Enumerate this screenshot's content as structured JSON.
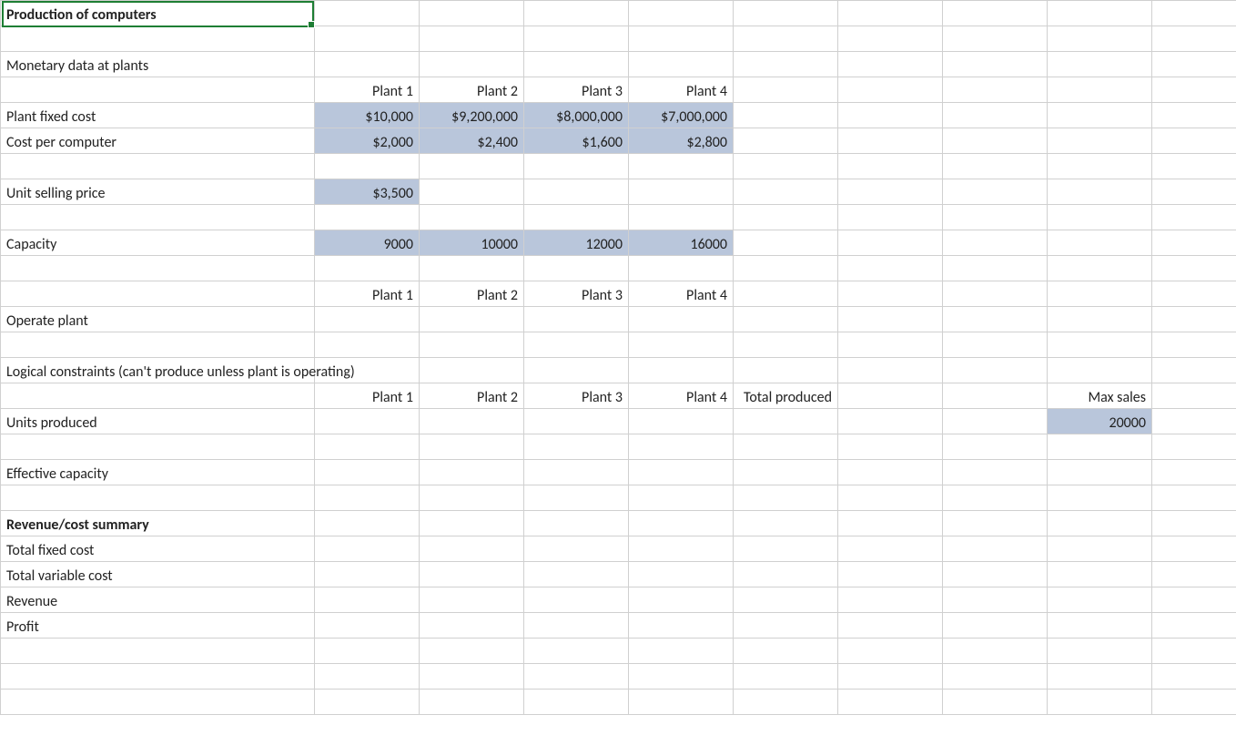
{
  "title": "Production of computers",
  "section_monetary": "Monetary data at plants",
  "plant_headers": [
    "Plant 1",
    "Plant 2",
    "Plant 3",
    "Plant 4"
  ],
  "label_fixed_cost": "Plant fixed cost",
  "fixed_cost": [
    "$10,000",
    "$9,200,000",
    "$8,000,000",
    "$7,000,000"
  ],
  "label_cost_per": "Cost per computer",
  "cost_per": [
    "$2,000",
    "$2,400",
    "$1,600",
    "$2,800"
  ],
  "label_unit_price": "Unit selling price",
  "unit_price": "$3,500",
  "label_capacity": "Capacity",
  "capacity": [
    "9000",
    "10000",
    "12000",
    "16000"
  ],
  "label_operate": "Operate plant",
  "label_logical": "Logical constraints (can't produce unless plant is operating)",
  "label_total_produced": "Total produced",
  "label_max_sales": "Max sales",
  "label_units_produced": "Units produced",
  "max_sales": "20000",
  "label_eff_capacity": "Effective capacity",
  "label_summary": "Revenue/cost summary",
  "label_total_fixed": "Total fixed cost",
  "label_total_variable": "Total variable cost",
  "label_revenue": "Revenue",
  "label_profit": "Profit"
}
